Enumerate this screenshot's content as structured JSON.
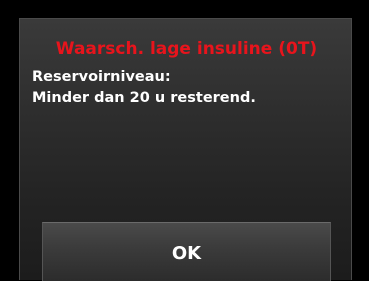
{
  "alert": {
    "title": "Waarsch. lage insuline (0T)",
    "title_color": "#e8141c",
    "message_line1": "Reservoirniveau:",
    "message_line2": "Minder dan 20 u resterend."
  },
  "actions": {
    "ok_label": "OK"
  }
}
